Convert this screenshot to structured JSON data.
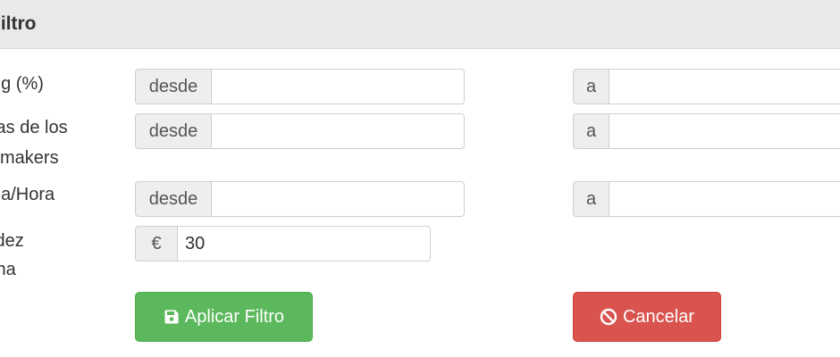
{
  "panel": {
    "title": "Filtro"
  },
  "rows": [
    {
      "label_lines": [
        "ng (%)"
      ],
      "from_addon": "desde",
      "from_value": "",
      "to_addon": "a",
      "to_value": ""
    },
    {
      "label_lines": [
        "tas de los",
        "kmakers"
      ],
      "from_addon": "desde",
      "from_value": "",
      "to_addon": "a",
      "to_value": ""
    },
    {
      "label_lines": [
        "na/Hora"
      ],
      "from_addon": "desde",
      "from_value": "",
      "to_addon": "a",
      "to_value": ""
    },
    {
      "label_lines": [
        "idez",
        "ma"
      ],
      "currency_addon": "€",
      "value": "30"
    }
  ],
  "buttons": {
    "apply": {
      "label": "Aplicar Filtro",
      "icon": "save-icon",
      "color": "#5cb85c"
    },
    "cancel": {
      "label": "Cancelar",
      "icon": "ban-icon",
      "color": "#d9534f"
    }
  }
}
